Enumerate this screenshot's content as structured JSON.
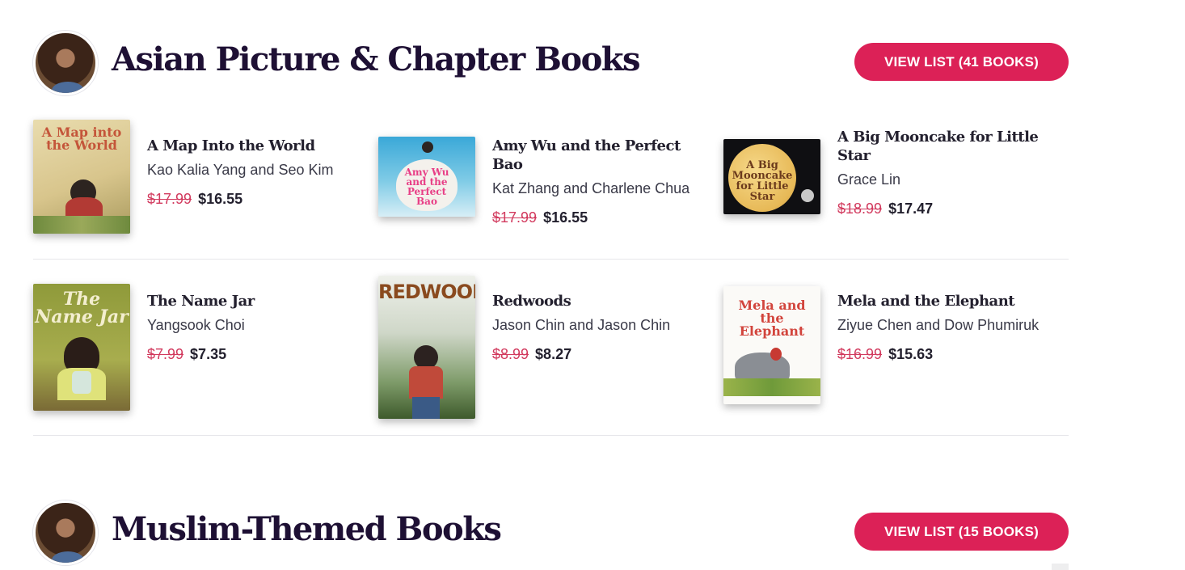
{
  "sections": [
    {
      "title": "Asian Picture & Chapter Books",
      "button_label": "VIEW LIST (41 BOOKS)",
      "books": [
        {
          "title": "A Map Into the World",
          "author": "Kao Kalia Yang and Seo Kim",
          "old_price": "$17.99",
          "new_price": "$16.55",
          "cover_text": "A Map into the World"
        },
        {
          "title": "Amy Wu and the Perfect Bao",
          "author": "Kat Zhang and Charlene Chua",
          "old_price": "$17.99",
          "new_price": "$16.55",
          "cover_text": "Amy Wu and the Perfect Bao"
        },
        {
          "title": "A Big Mooncake for Little Star",
          "author": "Grace Lin",
          "old_price": "$18.99",
          "new_price": "$17.47",
          "cover_text": "A Big Mooncake for Little Star"
        },
        {
          "title": "The Name Jar",
          "author": "Yangsook Choi",
          "old_price": "$7.99",
          "new_price": "$7.35",
          "cover_text": "The Name Jar"
        },
        {
          "title": "Redwoods",
          "author": "Jason Chin and Jason Chin",
          "old_price": "$8.99",
          "new_price": "$8.27",
          "cover_text": "REDWOODS"
        },
        {
          "title": "Mela and the Elephant",
          "author": "Ziyue Chen and Dow Phumiruk",
          "old_price": "$16.99",
          "new_price": "$15.63",
          "cover_text": "Mela and the Elephant"
        }
      ]
    },
    {
      "title": "Muslim-Themed Books",
      "button_label": "VIEW LIST (15 BOOKS)"
    }
  ],
  "colors": {
    "accent": "#dc2157",
    "title": "#1e1034",
    "strike_price": "#d23a5e"
  }
}
